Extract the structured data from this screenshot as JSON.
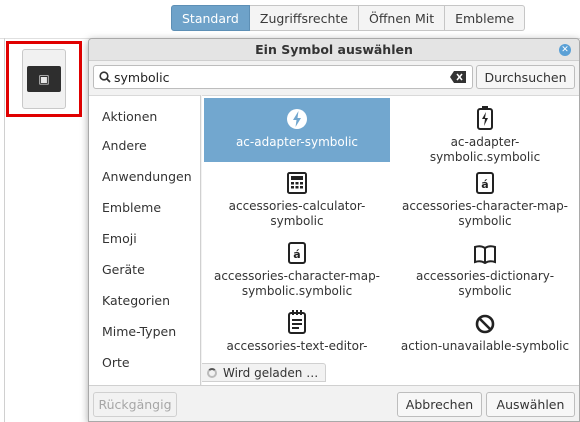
{
  "properties_window": {
    "tabs": [
      {
        "label": "Standard",
        "active": true
      },
      {
        "label": "Zugriffsrechte",
        "active": false
      },
      {
        "label": "Öffnen Mit",
        "active": false
      },
      {
        "label": "Embleme",
        "active": false
      }
    ],
    "icon_button_icon": "film-icon",
    "highlight_color": "#e00000"
  },
  "dialog": {
    "title": "Ein Symbol auswählen",
    "search": {
      "value": "symbolic",
      "placeholder": "",
      "button_label": "Durchsuchen"
    },
    "categories": [
      "Aktionen",
      "Andere",
      "Anwendungen",
      "Embleme",
      "Emoji",
      "Geräte",
      "Kategorien",
      "Mime-Typen",
      "Orte"
    ],
    "icons": [
      {
        "label": "ac-adapter-symbolic",
        "icon": "lightning-circle-icon",
        "selected": true
      },
      {
        "label": "ac-adapter-\nsymbolic.symbolic",
        "icon": "battery-charging-icon",
        "selected": false
      },
      {
        "label": "accessories-calculator-\nsymbolic",
        "icon": "calculator-icon",
        "selected": false
      },
      {
        "label": "accessories-character-map-\nsymbolic",
        "icon": "character-map-icon",
        "selected": false
      },
      {
        "label": "accessories-character-map-\nsymbolic.symbolic",
        "icon": "character-map-icon",
        "selected": false
      },
      {
        "label": "accessories-dictionary-\nsymbolic",
        "icon": "book-icon",
        "selected": false
      },
      {
        "label": "accessories-text-editor-",
        "icon": "text-editor-icon",
        "selected": false
      },
      {
        "label": "action-unavailable-symbolic",
        "icon": "no-entry-icon",
        "selected": false
      }
    ],
    "loading_text": "Wird geladen …",
    "footer": {
      "undo_label": "Rückgängig",
      "cancel_label": "Abbrechen",
      "select_label": "Auswählen"
    },
    "accent_color": "#72a7cf"
  }
}
